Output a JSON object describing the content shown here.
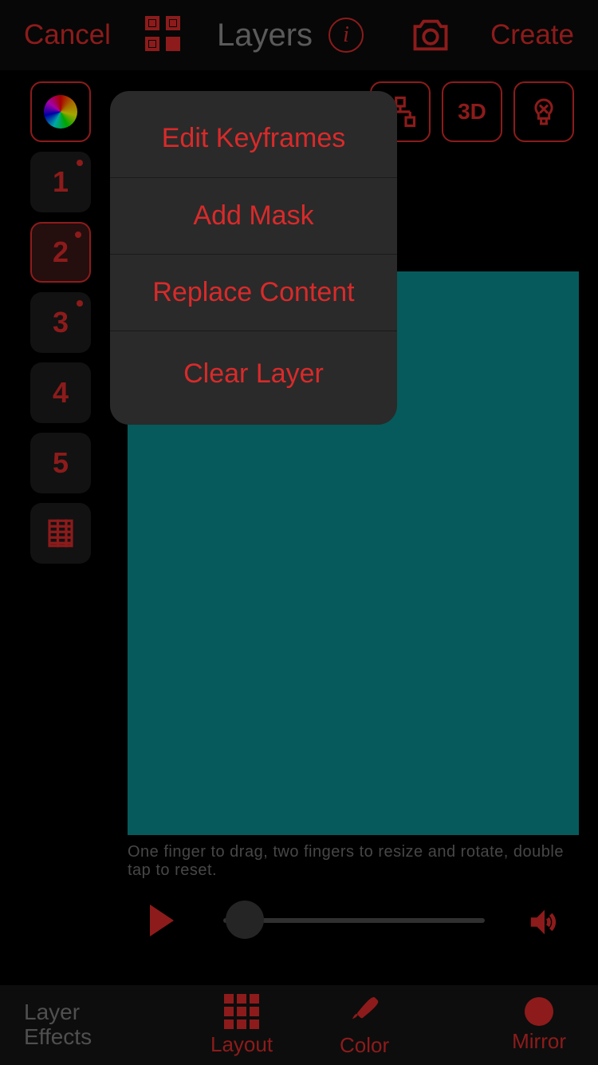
{
  "accent": "#d92a2a",
  "header": {
    "cancel": "Cancel",
    "title": "Layers",
    "create": "Create"
  },
  "sidebar": {
    "layers": [
      {
        "label": "1",
        "dot": true,
        "selected": false
      },
      {
        "label": "2",
        "dot": true,
        "selected": true
      },
      {
        "label": "3",
        "dot": true,
        "selected": false
      },
      {
        "label": "4",
        "dot": false,
        "selected": false
      },
      {
        "label": "5",
        "dot": false,
        "selected": false
      }
    ]
  },
  "top_right": {
    "three_d_label": "3D"
  },
  "canvas": {
    "hint": "One finger to drag, two fingers to resize and rotate, double tap to reset.",
    "color": "#0b8b8c"
  },
  "player": {
    "position": 0,
    "duration": 100
  },
  "bottombar": {
    "effects_label_line1": "Layer",
    "effects_label_line2": "Effects",
    "tabs": {
      "layout": "Layout",
      "color": "Color",
      "mirror": "Mirror"
    }
  },
  "menu": {
    "items": [
      {
        "label": "Edit Keyframes"
      },
      {
        "label": "Add Mask"
      },
      {
        "label": "Replace Content"
      },
      {
        "label": "Clear Layer"
      }
    ]
  }
}
